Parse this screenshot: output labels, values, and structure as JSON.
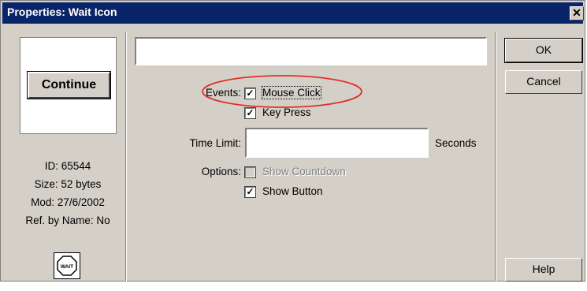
{
  "window": {
    "title": "Properties: Wait Icon",
    "close_glyph": "✕"
  },
  "preview": {
    "button_label": "Continue"
  },
  "info": {
    "id": "ID: 65544",
    "size": "Size: 52 bytes",
    "mod": "Mod: 27/6/2002",
    "ref": "Ref. by Name: No"
  },
  "icon": {
    "name": "wait-stop-icon",
    "label": "WAIT"
  },
  "name_field": {
    "value": ""
  },
  "events": {
    "label": "Events:",
    "mouse_click": {
      "label": "Mouse Click",
      "checked": true
    },
    "key_press": {
      "label": "Key Press",
      "checked": true
    }
  },
  "time_limit": {
    "label": "Time Limit:",
    "value": "",
    "unit": "Seconds"
  },
  "options": {
    "label": "Options:",
    "show_countdown": {
      "label": "Show Countdown",
      "checked": false,
      "enabled": false
    },
    "show_button": {
      "label": "Show Button",
      "checked": true
    }
  },
  "buttons": {
    "ok": "OK",
    "cancel": "Cancel",
    "help": "Help"
  },
  "annotation": {
    "color": "#e0302a"
  },
  "colors": {
    "titlebar": "#0a246a",
    "face": "#d4d0c8"
  }
}
